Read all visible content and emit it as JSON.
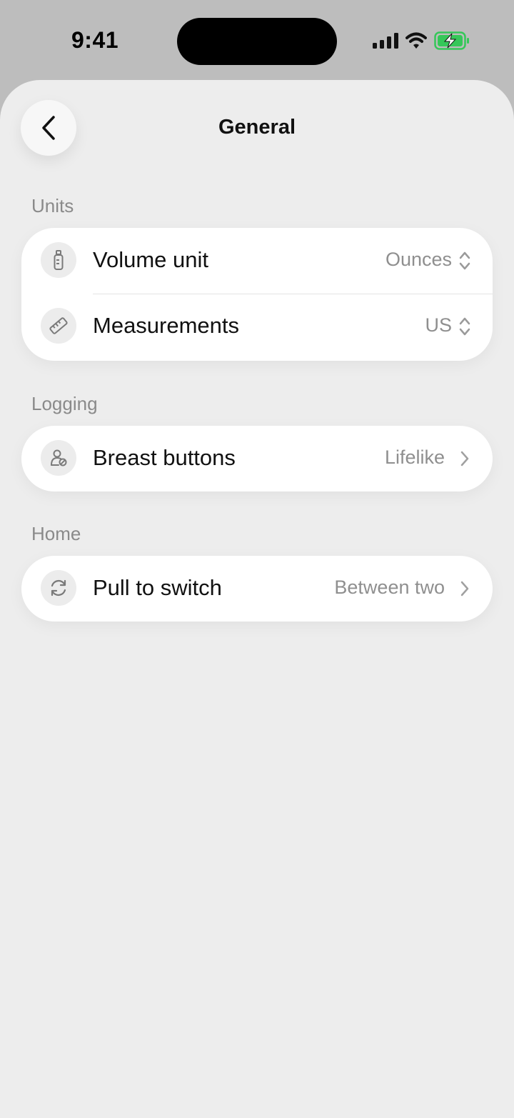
{
  "status_bar": {
    "time": "9:41"
  },
  "nav": {
    "title": "General"
  },
  "sections": {
    "units": {
      "label": "Units",
      "rows": [
        {
          "label": "Volume unit",
          "value": "Ounces",
          "icon": "bottle-icon"
        },
        {
          "label": "Measurements",
          "value": "US",
          "icon": "ruler-icon"
        }
      ]
    },
    "logging": {
      "label": "Logging",
      "rows": [
        {
          "label": "Breast buttons",
          "value": "Lifelike",
          "icon": "breast-icon"
        }
      ]
    },
    "home": {
      "label": "Home",
      "rows": [
        {
          "label": "Pull to switch",
          "value": "Between two",
          "icon": "refresh-icon"
        }
      ]
    }
  },
  "colors": {
    "background": "#ededed",
    "card": "#ffffff",
    "battery": "#35c759"
  }
}
